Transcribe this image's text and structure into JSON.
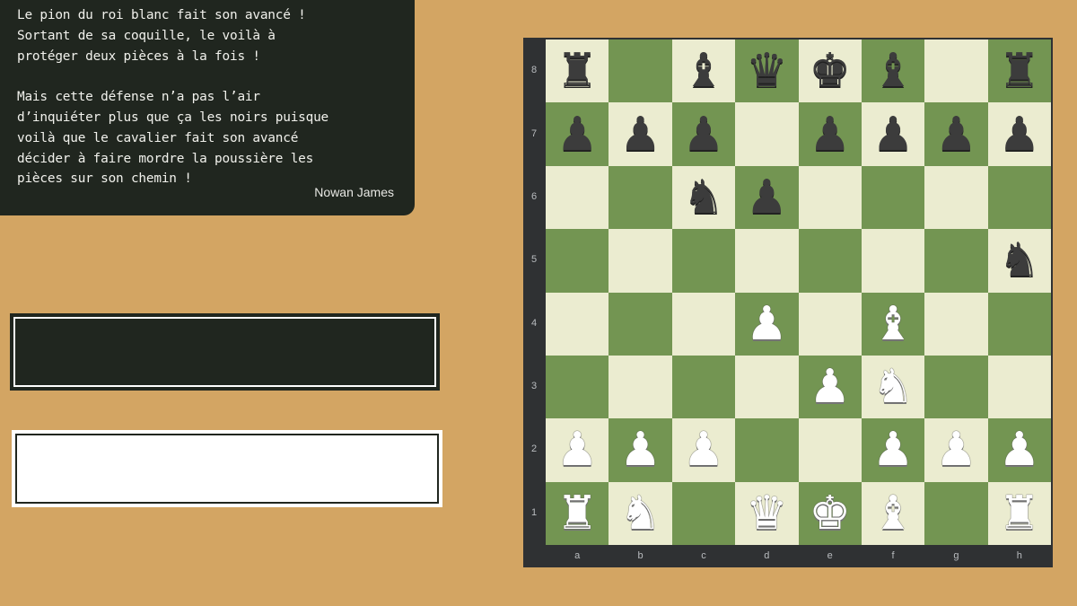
{
  "narration": {
    "text": "Le pion du roi blanc fait son avancé !\nSortant de sa coquille, le voilà à\nprotéger deux pièces à la fois !\n\nMais cette défense n’a pas l’air\nd’inquiéter plus que ça les noirs puisque\nvoilà que le cavalier fait son avancé\ndécider à faire mordre la poussière les\npièces sur son chemin !",
    "author": "Nowan James"
  },
  "players": {
    "black_name": "",
    "white_name": ""
  },
  "board": {
    "light_color": "#ebecd0",
    "dark_color": "#739552",
    "ranks": [
      "8",
      "7",
      "6",
      "5",
      "4",
      "3",
      "2",
      "1"
    ],
    "files": [
      "a",
      "b",
      "c",
      "d",
      "e",
      "f",
      "g",
      "h"
    ],
    "position": [
      [
        "r",
        "",
        "b",
        "q",
        "k",
        "b",
        "",
        "r"
      ],
      [
        "p",
        "p",
        "p",
        "",
        "p",
        "p",
        "p",
        "p"
      ],
      [
        "",
        "",
        "n",
        "p",
        "",
        "",
        "",
        ""
      ],
      [
        "",
        "",
        "",
        "",
        "",
        "",
        "",
        "n"
      ],
      [
        "",
        "",
        "",
        "P",
        "",
        "B",
        "",
        ""
      ],
      [
        "",
        "",
        "",
        "",
        "P",
        "N",
        "",
        ""
      ],
      [
        "P",
        "P",
        "P",
        "",
        "",
        "P",
        "P",
        "P"
      ],
      [
        "R",
        "N",
        "",
        "Q",
        "K",
        "B",
        "",
        "R"
      ]
    ]
  }
}
